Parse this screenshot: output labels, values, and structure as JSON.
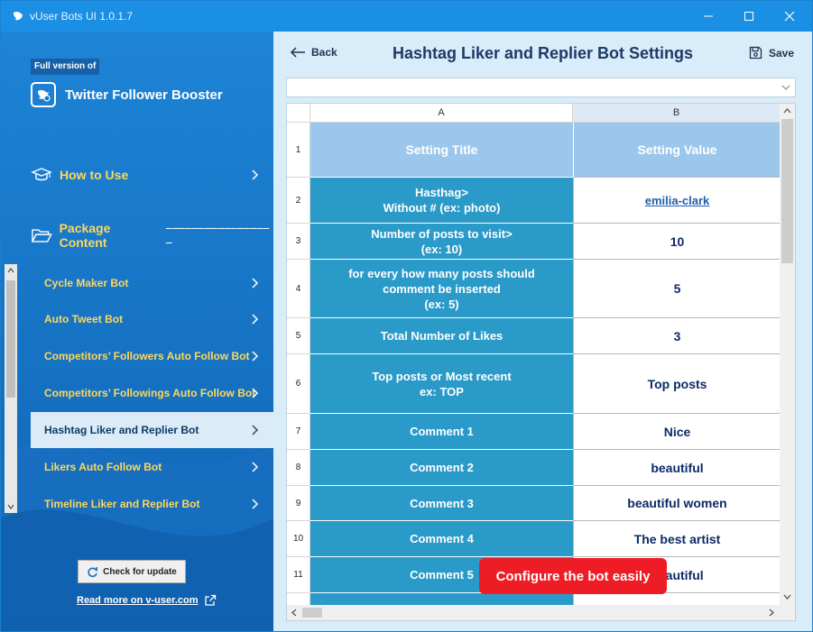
{
  "window": {
    "title": "vUser Bots UI 1.0.1.7"
  },
  "sidebar": {
    "badge": "Full version of",
    "app_name": "Twitter Follower Booster",
    "how_to_use": "How to Use",
    "package_content": "Package Content",
    "package_dash": "−−−−−−−−−−−−−−−−−",
    "items": [
      {
        "label": "Cycle Maker Bot"
      },
      {
        "label": "Auto Tweet Bot"
      },
      {
        "label": "Competitors’ Followers Auto Follow Bot"
      },
      {
        "label": "Competitors’ Followings Auto Follow Bot"
      },
      {
        "label": "Hashtag Liker and Replier Bot"
      },
      {
        "label": "Likers Auto Follow Bot"
      },
      {
        "label": "Timeline Liker and Replier Bot"
      }
    ],
    "active_item": "Hashtag Liker and Replier Bot",
    "update_button": "Check for update",
    "read_more": "Read more on v-user.com"
  },
  "main": {
    "back_label": "Back",
    "title": "Hashtag Liker and Replier Bot Settings",
    "save_label": "Save",
    "columns": [
      "A",
      "B"
    ],
    "rows": [
      {
        "num": "1",
        "a": "Setting Title",
        "b": "Setting Value"
      },
      {
        "num": "2",
        "a": "Hasthag>\nWithout # (ex: photo)",
        "b": "emilia-clark"
      },
      {
        "num": "3",
        "a": "Number of posts to visit>\n(ex: 10)",
        "b": "10"
      },
      {
        "num": "4",
        "a": "for every how many posts should\ncomment be inserted\n(ex: 5)",
        "b": "5"
      },
      {
        "num": "5",
        "a": "Total Number of Likes",
        "b": "3"
      },
      {
        "num": "6",
        "a": "Top posts or Most recent\nex: TOP",
        "b": "Top posts"
      },
      {
        "num": "7",
        "a": "Comment 1",
        "b": "Nice"
      },
      {
        "num": "8",
        "a": "Comment 2",
        "b": "beautiful"
      },
      {
        "num": "9",
        "a": "Comment 3",
        "b": "beautiful women"
      },
      {
        "num": "10",
        "a": "Comment 4",
        "b": "The best artist"
      },
      {
        "num": "11",
        "a": "Comment 5",
        "b": "beautiful"
      }
    ],
    "toast": "Configure the bot easily"
  }
}
